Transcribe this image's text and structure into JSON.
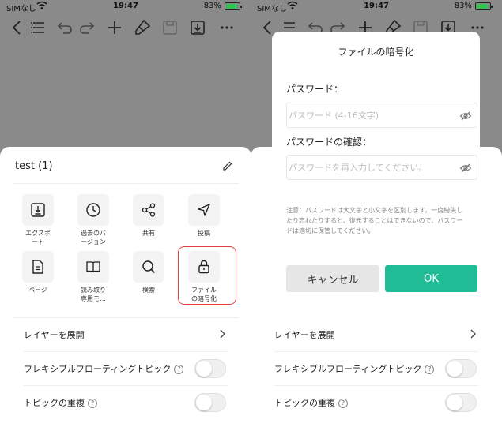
{
  "status_bar": {
    "carrier": "SIMなし",
    "time": "19:47",
    "battery": "83%",
    "battery_level": 0.83,
    "battery_color": "#33c24d"
  },
  "toolbar": {
    "icons": [
      "back-chevron-icon",
      "outline-list-icon",
      "undo-icon",
      "redo-icon",
      "add-icon",
      "brush-icon",
      "save-icon",
      "export-icon",
      "more-icon"
    ]
  },
  "sheet": {
    "title": "test (1)",
    "grid": [
      {
        "label": "エクスポ\nート",
        "icon": "export-icon"
      },
      {
        "label": "過去のバ\nージョン",
        "icon": "clock-icon"
      },
      {
        "label": "共有",
        "icon": "share-icon"
      },
      {
        "label": "投稿",
        "icon": "send-icon"
      },
      {
        "label": "ページ",
        "icon": "page-icon"
      },
      {
        "label": "読み取り\n専用モ…",
        "icon": "book-icon"
      },
      {
        "label": "検索",
        "icon": "search-icon"
      },
      {
        "label": "ファイル\nの暗号化",
        "icon": "lock-icon"
      }
    ],
    "highlight_color": "#e24040",
    "rows": [
      {
        "label": "レイヤーを展開",
        "type": "chevron"
      },
      {
        "label": "フレキシブルフローティングトピック",
        "type": "toggle",
        "help": "?"
      },
      {
        "label": "トピックの重複",
        "type": "toggle",
        "help": "?"
      }
    ]
  },
  "dialog": {
    "title": "ファイルの暗号化",
    "password_label": "パスワード：",
    "password_placeholder": "パスワード (4-16文字)",
    "confirm_label": "パスワードの確認：",
    "confirm_placeholder": "パスワードを再入力してください。",
    "note": "注意：パスワードは大文字と小文字を区別します。一度紛失したり忘れたりすると、復元することはできないので、パスワードは適切に保管してください。",
    "cancel": "キャンセル",
    "ok": "OK",
    "ok_color": "#1fbc95"
  },
  "dim_color": "#8a8a8a"
}
